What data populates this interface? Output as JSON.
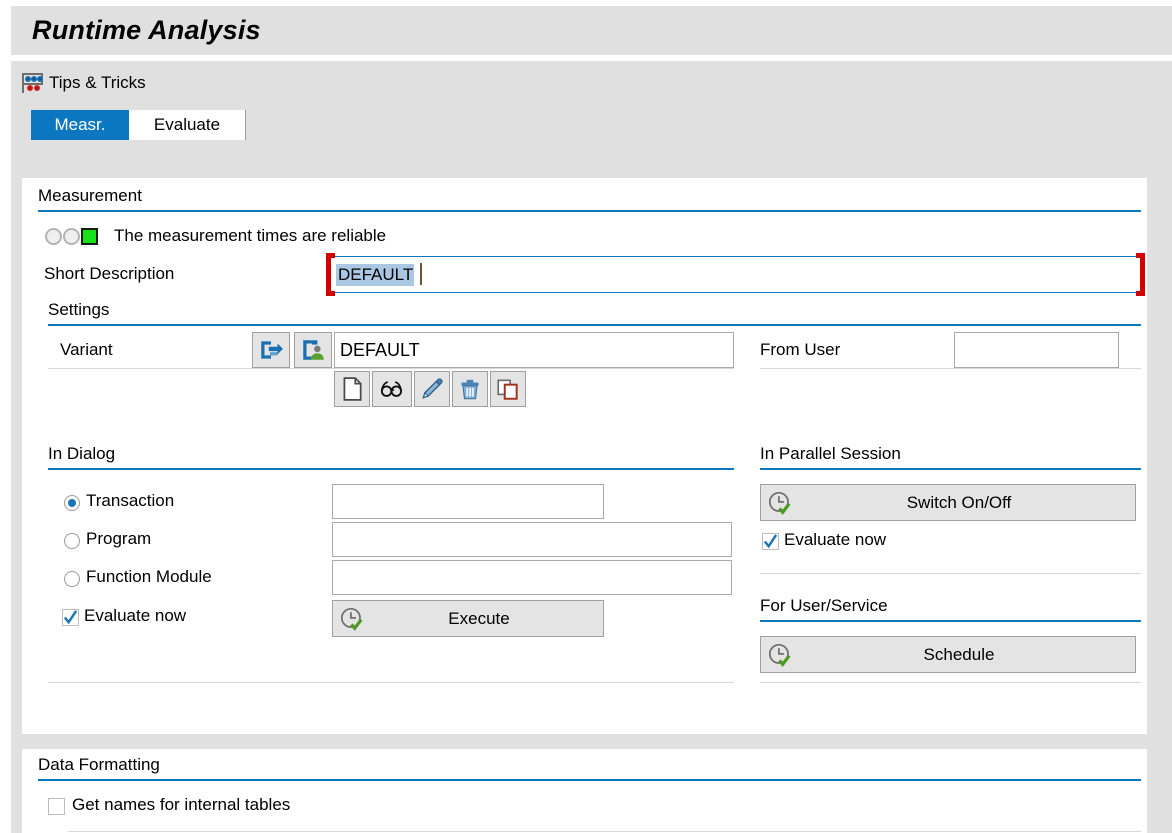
{
  "window": {
    "title": "Runtime Analysis"
  },
  "toolbar": {
    "tips_label": "Tips & Tricks",
    "tips_icon": "abacus-icon"
  },
  "tabs": [
    {
      "label": "Measr.",
      "active": true
    },
    {
      "label": "Evaluate",
      "active": false
    }
  ],
  "measurement": {
    "group_label": "Measurement",
    "status": {
      "icon": "traffic-light-green-icon",
      "text": "The measurement times are reliable",
      "lamps": [
        "off",
        "off",
        "green"
      ]
    },
    "short_description": {
      "label": "Short Description",
      "value": "DEFAULT",
      "placeholder": "",
      "required": true
    }
  },
  "settings": {
    "group_label": "Settings",
    "variant": {
      "label": "Variant",
      "value": "DEFAULT",
      "placeholder": "",
      "get_variant_icon": "get-variant-icon",
      "user_variant_icon": "user-variant-icon",
      "actions": [
        {
          "name": "create",
          "icon": "new-document-icon"
        },
        {
          "name": "display",
          "icon": "glasses-icon"
        },
        {
          "name": "change",
          "icon": "pencil-icon"
        },
        {
          "name": "delete",
          "icon": "trash-icon"
        },
        {
          "name": "copy",
          "icon": "copy-icon"
        }
      ]
    },
    "from_user": {
      "label": "From User",
      "value": "",
      "placeholder": ""
    }
  },
  "in_dialog": {
    "group_label": "In Dialog",
    "options": [
      {
        "label": "Transaction",
        "selected": true,
        "value": "",
        "placeholder": ""
      },
      {
        "label": "Program",
        "selected": false,
        "value": "",
        "placeholder": ""
      },
      {
        "label": "Function Module",
        "selected": false,
        "value": "",
        "placeholder": ""
      }
    ],
    "evaluate_now": {
      "label": "Evaluate now",
      "checked": true
    },
    "execute_button": {
      "label": "Execute",
      "icon": "clock-check-icon"
    }
  },
  "in_parallel_session": {
    "group_label": "In Parallel Session",
    "switch_button": {
      "label": "Switch On/Off",
      "icon": "clock-check-icon"
    },
    "evaluate_now": {
      "label": "Evaluate now",
      "checked": true
    }
  },
  "for_user_service": {
    "group_label": "For User/Service",
    "schedule_button": {
      "label": "Schedule",
      "icon": "clock-check-icon"
    }
  },
  "data_formatting": {
    "group_label": "Data Formatting",
    "get_names": {
      "label": "Get names for internal tables",
      "checked": false
    }
  },
  "colors": {
    "accent": "#0a77c0",
    "window_bg": "#e0e0e0",
    "panel_bg": "#ffffff",
    "required_marker": "#d40000",
    "status_green": "#18e018"
  }
}
